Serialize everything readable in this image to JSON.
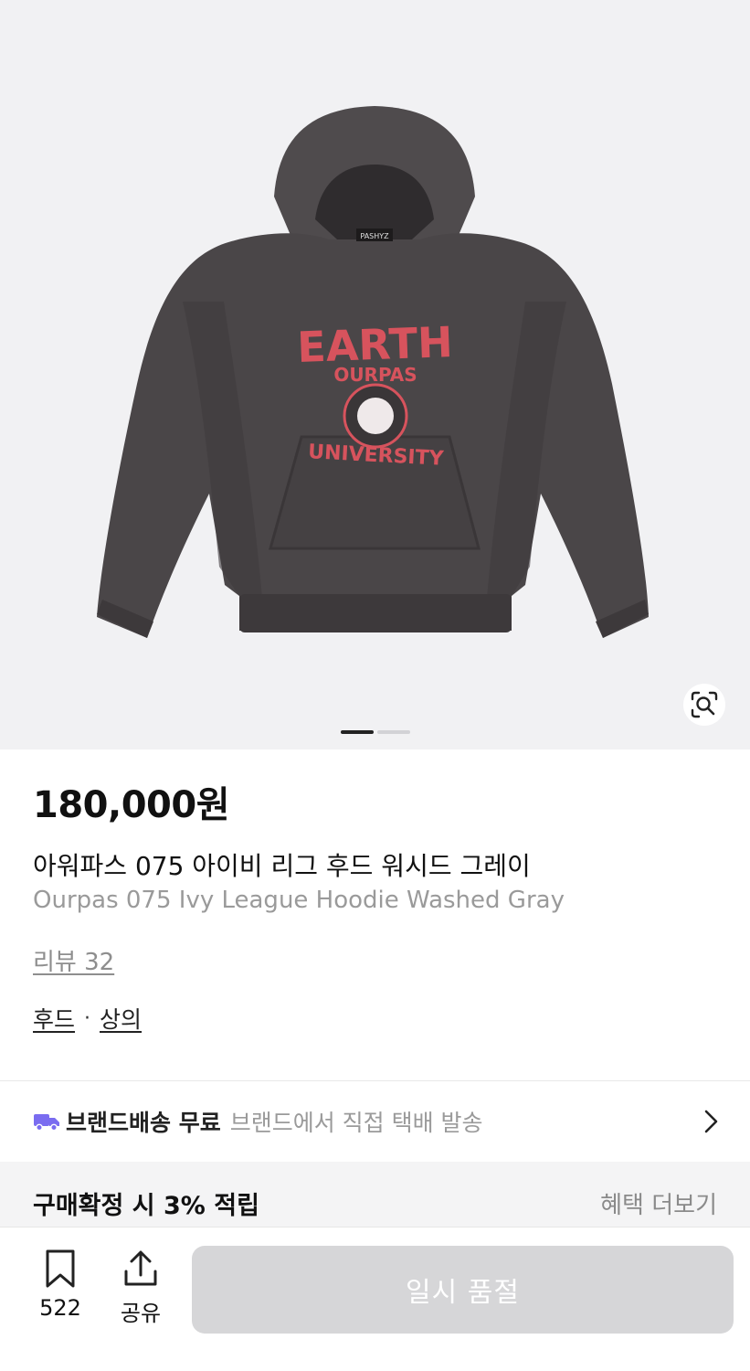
{
  "gallery": {
    "image_alt": "Ourpas 075 Ivy League Hoodie Washed Gray",
    "print_line1": "EARTH",
    "print_line2": "OURPAS",
    "print_line3": "UNIVERSITY",
    "hood_tag": "PASHYZ",
    "page_count": 2,
    "current_page": 1
  },
  "product": {
    "price": "180,000원",
    "name_ko": "아워파스 075 아이비 리그 후드 워시드 그레이",
    "name_en": "Ourpas 075 Ivy League Hoodie Washed Gray",
    "review_label": "리뷰 32",
    "categories": [
      "후드",
      "상의"
    ],
    "category_separator": "·"
  },
  "shipping": {
    "title": "브랜드배송 무료",
    "description": "브랜드에서 직접 택배 발송",
    "icon": "truck-icon"
  },
  "benefit": {
    "title": "구매확정 시 3% 적립",
    "more_label": "혜택 더보기"
  },
  "bottom_bar": {
    "bookmark_count": "522",
    "share_label": "공유",
    "soldout_label": "일시 품절"
  },
  "colors": {
    "accent_purple": "#7a6cf0",
    "soldout_button": "#d6d6d8",
    "hoodie_gray": "#4a4648",
    "print_red": "#d7535d"
  }
}
